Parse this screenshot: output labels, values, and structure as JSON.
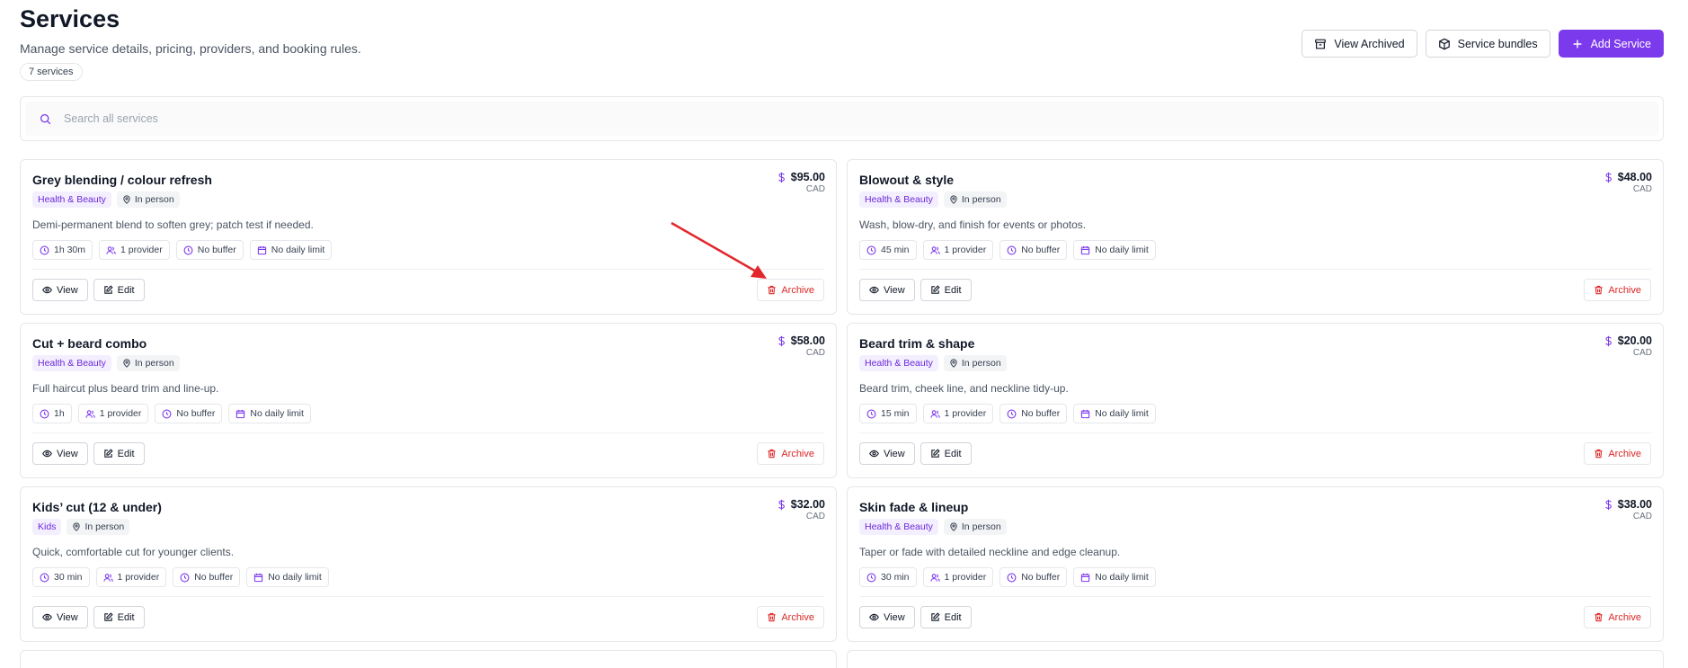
{
  "header": {
    "title": "Services",
    "subtitle": "Manage service details, pricing, providers, and booking rules.",
    "count": "7 services"
  },
  "actions": {
    "view_archived": "View Archived",
    "service_bundles": "Service bundles",
    "add_service": "Add Service"
  },
  "search": {
    "placeholder": "Search all services"
  },
  "card_buttons": {
    "view": "View",
    "edit": "Edit",
    "archive": "Archive"
  },
  "colors": {
    "accent": "#7c3aed",
    "danger": "#dc2626",
    "annotation": "#e3262b"
  },
  "services": [
    {
      "name": "Grey blending / colour refresh",
      "price": "$95.00",
      "currency": "CAD",
      "category": "Health & Beauty",
      "location": "In person",
      "description": "Demi-permanent blend to soften grey; patch test if needed.",
      "duration": "1h 30m",
      "providers": "1 provider",
      "buffer": "No buffer",
      "limit": "No daily limit"
    },
    {
      "name": "Blowout & style",
      "price": "$48.00",
      "currency": "CAD",
      "category": "Health & Beauty",
      "location": "In person",
      "description": "Wash, blow-dry, and finish for events or photos.",
      "duration": "45 min",
      "providers": "1 provider",
      "buffer": "No buffer",
      "limit": "No daily limit"
    },
    {
      "name": "Cut + beard combo",
      "price": "$58.00",
      "currency": "CAD",
      "category": "Health & Beauty",
      "location": "In person",
      "description": "Full haircut plus beard trim and line-up.",
      "duration": "1h",
      "providers": "1 provider",
      "buffer": "No buffer",
      "limit": "No daily limit"
    },
    {
      "name": "Beard trim & shape",
      "price": "$20.00",
      "currency": "CAD",
      "category": "Health & Beauty",
      "location": "In person",
      "description": "Beard trim, cheek line, and neckline tidy-up.",
      "duration": "15 min",
      "providers": "1 provider",
      "buffer": "No buffer",
      "limit": "No daily limit"
    },
    {
      "name": "Kids’ cut (12 & under)",
      "price": "$32.00",
      "currency": "CAD",
      "category": "Kids",
      "location": "In person",
      "description": "Quick, comfortable cut for younger clients.",
      "duration": "30 min",
      "providers": "1 provider",
      "buffer": "No buffer",
      "limit": "No daily limit"
    },
    {
      "name": "Skin fade & lineup",
      "price": "$38.00",
      "currency": "CAD",
      "category": "Health & Beauty",
      "location": "In person",
      "description": "Taper or fade with detailed neckline and edge cleanup.",
      "duration": "30 min",
      "providers": "1 provider",
      "buffer": "No buffer",
      "limit": "No daily limit"
    }
  ]
}
